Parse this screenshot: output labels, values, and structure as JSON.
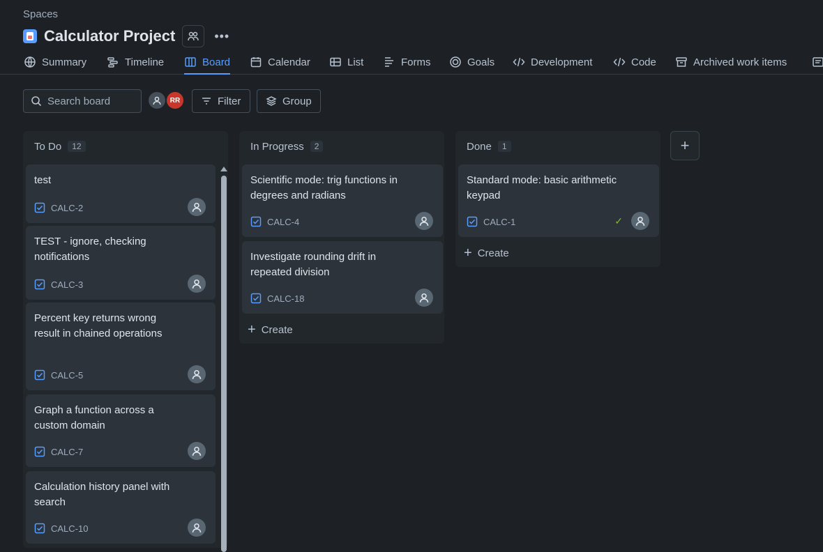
{
  "breadcrumb": "Spaces",
  "project": {
    "title": "Calculator Project"
  },
  "tabs": [
    {
      "label": "Summary",
      "icon": "globe-icon"
    },
    {
      "label": "Timeline",
      "icon": "timeline-icon"
    },
    {
      "label": "Board",
      "icon": "board-icon",
      "active": true
    },
    {
      "label": "Calendar",
      "icon": "calendar-icon"
    },
    {
      "label": "List",
      "icon": "list-icon"
    },
    {
      "label": "Forms",
      "icon": "forms-icon"
    },
    {
      "label": "Goals",
      "icon": "goals-icon"
    },
    {
      "label": "Development",
      "icon": "development-icon"
    },
    {
      "label": "Code",
      "icon": "code-icon"
    },
    {
      "label": "Archived work items",
      "icon": "archive-icon"
    }
  ],
  "toolbar": {
    "search_placeholder": "Search board",
    "avatar_initials": "RR",
    "filter_label": "Filter",
    "group_label": "Group"
  },
  "columns": [
    {
      "title": "To Do",
      "count": "12",
      "cards": [
        {
          "title": "test",
          "key": "CALC-2"
        },
        {
          "title": "TEST - ignore, checking notifications",
          "key": "CALC-3"
        },
        {
          "title": "Percent key returns wrong result in chained operations",
          "key": "CALC-5"
        },
        {
          "title": "Graph a function across a custom domain",
          "key": "CALC-7"
        },
        {
          "title": "Calculation history panel with search",
          "key": "CALC-10"
        }
      ]
    },
    {
      "title": "In Progress",
      "count": "2",
      "cards": [
        {
          "title": "Scientific mode: trig functions in degrees and radians",
          "key": "CALC-4"
        },
        {
          "title": "Investigate rounding drift in repeated division",
          "key": "CALC-18"
        }
      ],
      "create_label": "Create"
    },
    {
      "title": "Done",
      "count": "1",
      "cards": [
        {
          "title": "Standard mode: basic arithmetic keypad",
          "key": "CALC-1",
          "done": true
        }
      ],
      "create_label": "Create"
    }
  ],
  "colors": {
    "accent": "#579dff",
    "background": "#1d2125",
    "card": "#2c333a",
    "done_check": "#82b536"
  }
}
